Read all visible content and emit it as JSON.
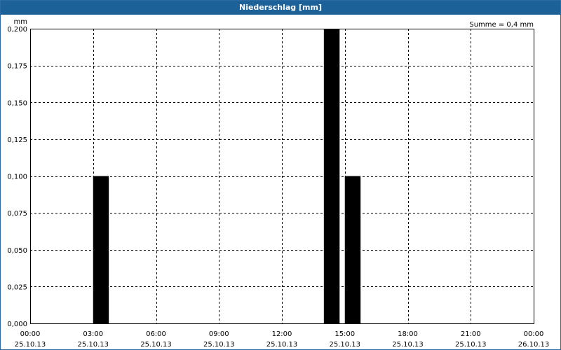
{
  "window": {
    "title": "Niederschlag [mm]"
  },
  "colors": {
    "title_bar": "#1d6199",
    "bar_fill": "#000000",
    "grid": "#000000"
  },
  "chart_data": {
    "type": "bar",
    "title": "Niederschlag [mm]",
    "ylabel": "mm",
    "annotation": "Summe = 0,4 mm",
    "ylim": [
      0,
      0.2
    ],
    "grid": true,
    "grid_style": "dashed",
    "y_ticks": [
      "0,000",
      "0,025",
      "0,050",
      "0,075",
      "0,100",
      "0,125",
      "0,150",
      "0,175",
      "0,200"
    ],
    "y_tick_values": [
      0,
      0.025,
      0.05,
      0.075,
      0.1,
      0.125,
      0.15,
      0.175,
      0.2
    ],
    "x_range_hours": [
      0,
      24
    ],
    "x_ticks": [
      {
        "hour": 0,
        "time": "00:00",
        "date": "25.10.13"
      },
      {
        "hour": 3,
        "time": "03:00",
        "date": "25.10.13"
      },
      {
        "hour": 6,
        "time": "06:00",
        "date": "25.10.13"
      },
      {
        "hour": 9,
        "time": "09:00",
        "date": "25.10.13"
      },
      {
        "hour": 12,
        "time": "12:00",
        "date": "25.10.13"
      },
      {
        "hour": 15,
        "time": "15:00",
        "date": "25.10.13"
      },
      {
        "hour": 18,
        "time": "18:00",
        "date": "25.10.13"
      },
      {
        "hour": 21,
        "time": "21:00",
        "date": "25.10.13"
      },
      {
        "hour": 24,
        "time": "00:00",
        "date": "26.10.13"
      }
    ],
    "bars": [
      {
        "start_hour": 3.0,
        "end_hour": 3.75,
        "value": 0.1
      },
      {
        "start_hour": 14.0,
        "end_hour": 14.75,
        "value": 0.2
      },
      {
        "start_hour": 15.0,
        "end_hour": 15.75,
        "value": 0.1
      }
    ]
  }
}
